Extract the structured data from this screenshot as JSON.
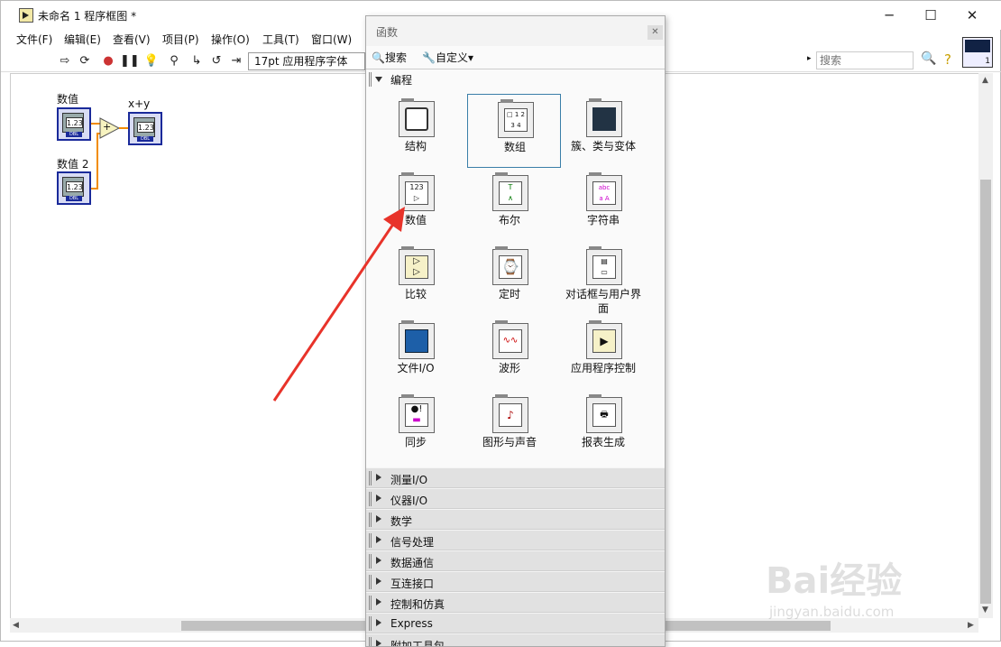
{
  "window": {
    "title": "未命名 1 程序框图 *",
    "minimize": "─",
    "maximize": "☐",
    "close": "✕"
  },
  "menu": [
    "文件(F)",
    "编辑(E)",
    "查看(V)",
    "项目(P)",
    "操作(O)",
    "工具(T)",
    "窗口(W)"
  ],
  "toolbar": {
    "font": "17pt 应用程序字体",
    "search_placeholder": "搜索"
  },
  "diagram": {
    "input1_label": "数值",
    "input2_label": "数值 2",
    "output_label": "x+y",
    "add_symbol": "+",
    "numeric_text": "1.23",
    "dbl_text": "DBL"
  },
  "palette": {
    "title": "函数",
    "search_label": "搜索",
    "customize_label": "自定义▾",
    "section_programming": "编程",
    "items": [
      {
        "label": "结构",
        "icon": "structures-icon"
      },
      {
        "label": "数组",
        "icon": "array-icon"
      },
      {
        "label": "簇、类与变体",
        "icon": "cluster-icon"
      },
      {
        "label": "数值",
        "icon": "numeric-icon"
      },
      {
        "label": "布尔",
        "icon": "boolean-icon"
      },
      {
        "label": "字符串",
        "icon": "string-icon"
      },
      {
        "label": "比较",
        "icon": "comparison-icon"
      },
      {
        "label": "定时",
        "icon": "timing-icon"
      },
      {
        "label": "对话框与用户界面",
        "icon": "dialog-icon"
      },
      {
        "label": "文件I/O",
        "icon": "file-io-icon"
      },
      {
        "label": "波形",
        "icon": "waveform-icon"
      },
      {
        "label": "应用程序控制",
        "icon": "app-control-icon"
      },
      {
        "label": "同步",
        "icon": "sync-icon"
      },
      {
        "label": "图形与声音",
        "icon": "graphics-sound-icon"
      },
      {
        "label": "报表生成",
        "icon": "report-icon"
      }
    ],
    "categories": [
      "测量I/O",
      "仪器I/O",
      "数学",
      "信号处理",
      "数据通信",
      "互连接口",
      "控制和仿真",
      "Express",
      "附加工具包"
    ],
    "selected": "数组"
  },
  "watermark": {
    "brand": "Bai经验",
    "url": "jingyan.baidu.com"
  },
  "colors": {
    "terminal_border": "#1a2a9a",
    "selection": "#3a7ea8",
    "arrow": "#e8332a"
  }
}
